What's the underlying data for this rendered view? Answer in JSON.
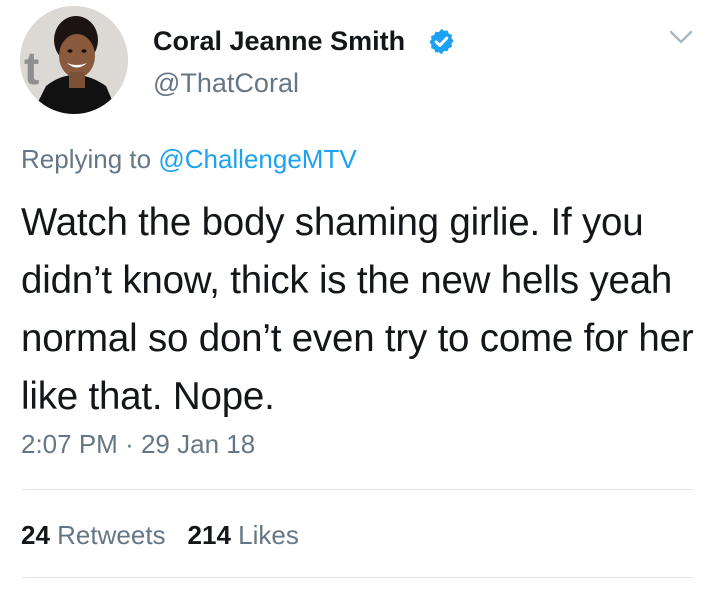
{
  "author": {
    "display_name": "Coral Jeanne Smith",
    "handle": "@ThatCoral",
    "verified": true,
    "avatar_icon": "profile-photo",
    "verified_icon": "verified-badge-icon"
  },
  "menu": {
    "icon": "chevron-down-icon"
  },
  "reply": {
    "prefix": "Replying to",
    "mention": "@ChallengeMTV"
  },
  "tweet": {
    "text": "Watch the body shaming girlie. If you didn’t know, thick is the new hells yeah normal so don’t even try to come for her like that. Nope.",
    "time": "2:07 PM",
    "separator": "·",
    "date": "29 Jan 18"
  },
  "stats": {
    "retweets_count": "24",
    "retweets_label": "Retweets",
    "likes_count": "214",
    "likes_label": "Likes"
  },
  "colors": {
    "text_primary": "#14171a",
    "text_secondary": "#657786",
    "accent": "#1da1f2",
    "divider": "#e1e8ed"
  }
}
